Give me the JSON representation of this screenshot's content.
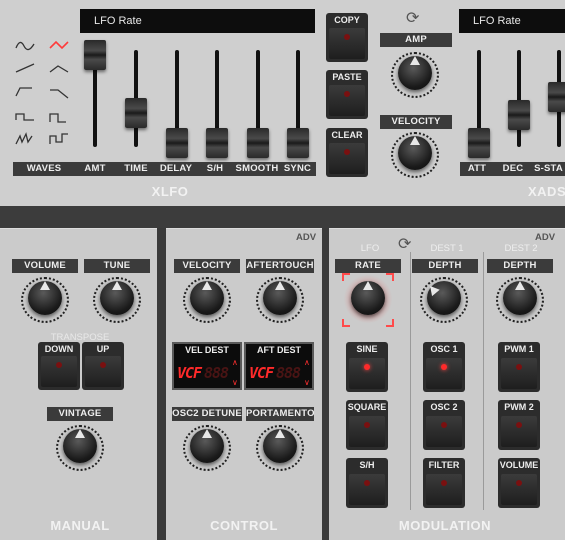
{
  "xlfo": {
    "lcd": "LFO Rate",
    "title": "XLFO",
    "labels": [
      "WAVES",
      "AMT",
      "TIME",
      "DELAY",
      "S/H",
      "SMOOTH",
      "SYNC"
    ],
    "buttons": {
      "copy": "COPY",
      "paste": "PASTE",
      "clear": "CLEAR"
    },
    "amp_label": "AMP",
    "velocity_label": "VELOCITY",
    "fader_levels": {
      "amt": 0.95,
      "time": 0.55,
      "delay": 0.2,
      "sh": 0.2,
      "smooth": 0.2,
      "sync": 0.2
    }
  },
  "xads": {
    "lcd": "LFO Rate",
    "title": "XADS",
    "labels": [
      "ATT",
      "DEC",
      "S-STA"
    ]
  },
  "manual": {
    "title": "MANUAL",
    "volume_label": "VOLUME",
    "tune_label": "TUNE",
    "transpose_label": "TRANSPOSE",
    "down_label": "DOWN",
    "up_label": "UP",
    "vintage_label": "VINTAGE"
  },
  "control": {
    "title": "CONTROL",
    "adv": "ADV",
    "velocity_label": "VELOCITY",
    "aftertouch_label": "AFTERTOUCH",
    "vel_dest_label": "VEL DEST",
    "aft_dest_label": "AFT DEST",
    "vel_dest_value": "VCF",
    "aft_dest_value": "VCF",
    "seg_ghost": "888",
    "osc2_detune_label": "OSC2 DETUNE",
    "portamento_label": "PORTAMENTO"
  },
  "modulation": {
    "title": "MODULATION",
    "adv": "ADV",
    "lfo_label": "LFO",
    "dest1_label": "DEST 1",
    "dest2_label": "DEST 2",
    "rate_label": "RATE",
    "depth1_label": "DEPTH",
    "depth2_label": "DEPTH",
    "lfo_buttons": [
      "SINE",
      "SQUARE",
      "S/H"
    ],
    "dest1_buttons": [
      "OSC 1",
      "OSC 2",
      "FILTER"
    ],
    "dest2_buttons": [
      "PWM 1",
      "PWM 2",
      "VOLUME"
    ]
  },
  "colors": {
    "accent": "#ff2a2a",
    "panel": "#c8c8c8",
    "dark": "#3b3b3b"
  }
}
